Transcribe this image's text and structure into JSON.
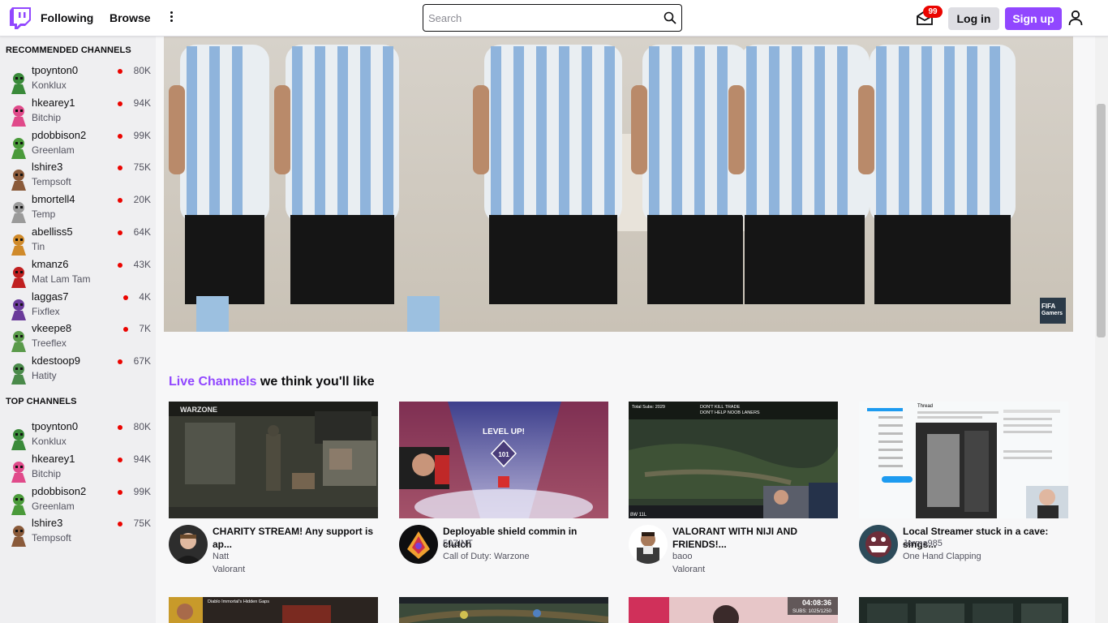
{
  "nav": {
    "following": "Following",
    "browse": "Browse",
    "search_placeholder": "Search",
    "notification_count": "99",
    "login": "Log in",
    "signup": "Sign up"
  },
  "sidebar": {
    "recommended_header": "RECOMMENDED CHANNELS",
    "top_header": "TOP CHANNELS",
    "recommended": [
      {
        "name": "tpoynton0",
        "game": "Konklux",
        "viewers": "80K"
      },
      {
        "name": "hkearey1",
        "game": "Bitchip",
        "viewers": "94K"
      },
      {
        "name": "pdobbison2",
        "game": "Greenlam",
        "viewers": "99K"
      },
      {
        "name": "lshire3",
        "game": "Tempsoft",
        "viewers": "75K"
      },
      {
        "name": "bmortell4",
        "game": "Temp",
        "viewers": "20K"
      },
      {
        "name": "abelliss5",
        "game": "Tin",
        "viewers": "64K"
      },
      {
        "name": "kmanz6",
        "game": "Mat Lam Tam",
        "viewers": "43K"
      },
      {
        "name": "laggas7",
        "game": "Fixflex",
        "viewers": "4K"
      },
      {
        "name": "vkeepe8",
        "game": "Treeflex",
        "viewers": "7K"
      },
      {
        "name": "kdestoop9",
        "game": "Hatity",
        "viewers": "67K"
      }
    ],
    "top": [
      {
        "name": "tpoynton0",
        "game": "Konklux",
        "viewers": "80K"
      },
      {
        "name": "hkearey1",
        "game": "Bitchip",
        "viewers": "94K"
      },
      {
        "name": "pdobbison2",
        "game": "Greenlam",
        "viewers": "99K"
      },
      {
        "name": "lshire3",
        "game": "Tempsoft",
        "viewers": "75K"
      }
    ]
  },
  "hero": {
    "badge_line1": "FIFA",
    "badge_line2": "Gamers"
  },
  "section": {
    "accent": "Live Channels",
    "rest": " we think you'll like"
  },
  "cards": [
    {
      "title": "CHARITY STREAM! Any support is ap...",
      "channel": "Natt",
      "category": "Valorant"
    },
    {
      "title": "Deployable shield commin in clutch",
      "channel": "50ZINT",
      "category": "Call of Duty: Warzone"
    },
    {
      "title": "VALORANT WITH NIJI AND FRIENDS!...",
      "channel": "baoo",
      "category": "Valorant"
    },
    {
      "title": "Local Streamer stuck in a cave: sings...",
      "channel": "Jerma985",
      "category": "One Hand Clapping"
    }
  ],
  "thumb_text": {
    "warzone": "WARZONE",
    "levelup": "LEVEL UP!",
    "level_num": "101",
    "subs_total": "Total Subs: 2029",
    "dont_kill": "DON'T KILL TRADE",
    "dont_help": "DON'T HELP NOOB LANERS",
    "lol_score": "8W 11L",
    "tweet_header": "Thread",
    "timer": "04:08:36",
    "subs": "SUBS: 1025/1250",
    "diablo": "Diablo Immortal's Hidden Gaps"
  }
}
